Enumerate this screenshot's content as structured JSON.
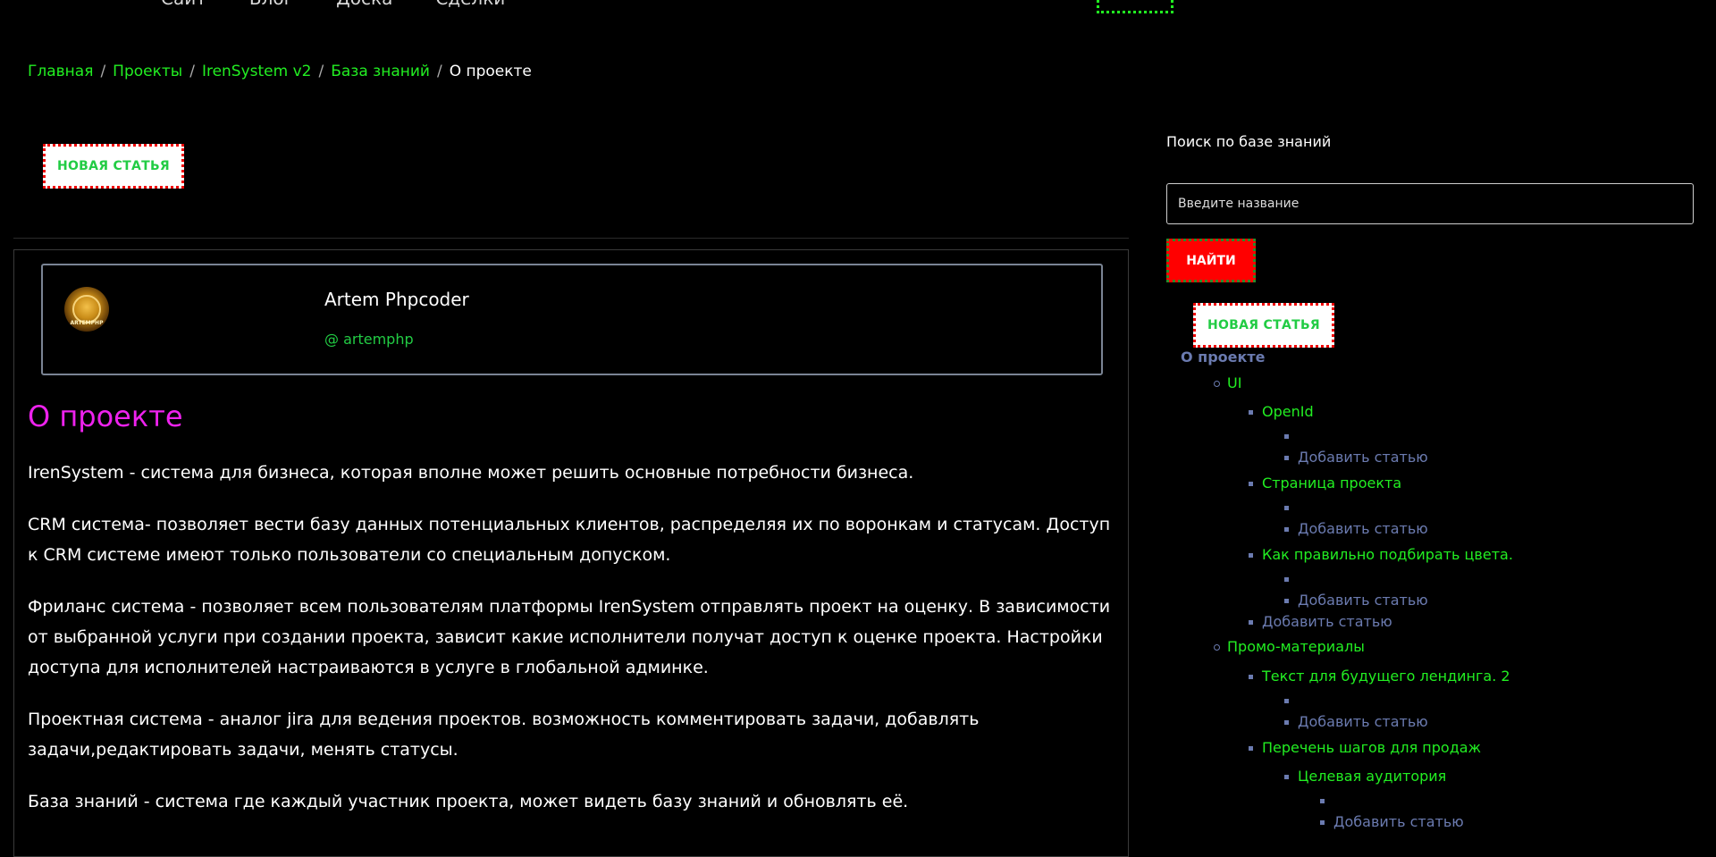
{
  "nav": {
    "items": [
      "Сайт",
      "Блог",
      "Доска",
      "Сделки"
    ]
  },
  "breadcrumb": [
    {
      "label": "Главная"
    },
    {
      "label": "Проекты"
    },
    {
      "label": "IrenSystem v2"
    },
    {
      "label": "База знаний"
    },
    {
      "label": "О проекте"
    }
  ],
  "new_article_label": "НОВАЯ СТАТЬЯ",
  "author": {
    "name": "Artem Phpcoder",
    "handle": "@ artemphp",
    "avatar_text": "ARTEMPHP"
  },
  "article": {
    "title": "О проекте",
    "paragraphs": [
      "IrenSystem - система для бизнеса, которая вполне может решить основные потребности бизнеса.",
      "CRM система- позволяет вести базу данных потенциальных клиентов, распределяя их по воронкам  и статусам. Доступ к CRM системе имеют только пользователи со специальным допуском.",
      "Фриланс система - позволяет всем пользователям платформы IrenSystem отправлять проект на оценку. В зависимости от выбранной услуги при создании проекта, зависит какие исполнители получат доступ к оценке проекта. Настройки доступа для исполнителей настраиваются в услуге в глобальной админке.",
      "Проектная система -  аналог jira для ведения проектов.  возможность комментировать задачи, добавлять задачи,редактировать задачи, менять статусы.",
      "База знаний - система где каждый участник проекта, может видеть базу знаний и обновлять её."
    ]
  },
  "sidebar": {
    "search_label": "Поиск по базе знаний",
    "search_placeholder": "Введите название",
    "search_value": "",
    "find_label": "НАЙТИ",
    "tree": {
      "root": "О проекте",
      "add_label": "Добавить статью",
      "ui": "UI",
      "openid": "OpenId",
      "project_page": "Страница проекта",
      "colors": "Как правильно подбирать цвета.",
      "promo": "Промо-материалы",
      "landing_text": "Текст для будущего лендинга. 2",
      "sales_steps": "Перечень шагов для продаж",
      "target_audience": "Целевая аудитория"
    }
  },
  "colors": {
    "link_green": "#22ee22",
    "title_magenta": "#ee22ee",
    "find_red": "#ff0000",
    "tree_muted": "#6b7bb0"
  }
}
